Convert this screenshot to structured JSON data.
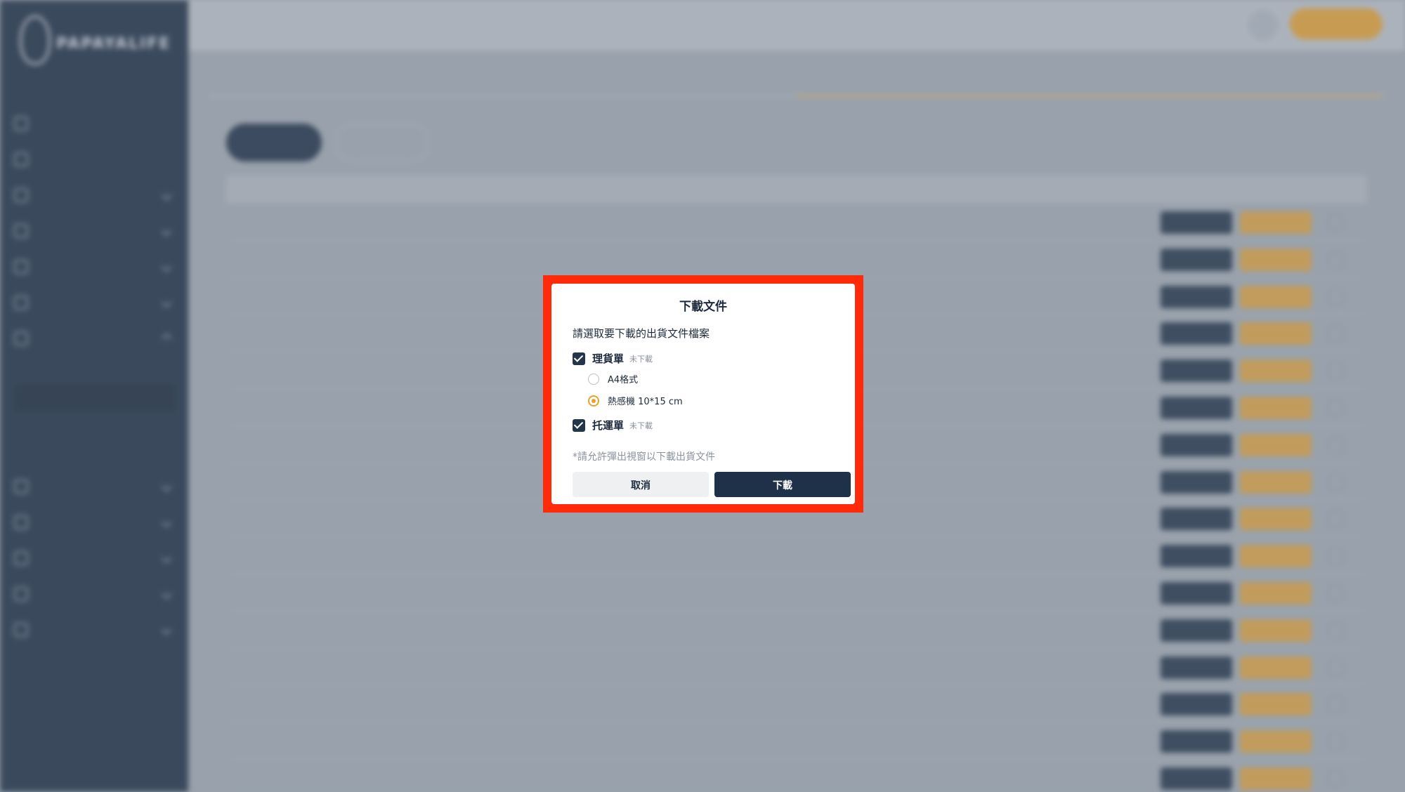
{
  "app": {
    "brand": "PAPAYALIFE",
    "brand_sub": "",
    "page_title": "",
    "breadcrumbs": [
      "",
      ""
    ],
    "user_label": ""
  },
  "sidebar": {
    "items": [
      {
        "label": "",
        "icon": "home-icon"
      },
      {
        "label": "",
        "icon": "chart-icon"
      },
      {
        "label": "",
        "icon": "store-icon"
      },
      {
        "label": "",
        "icon": "page-icon"
      },
      {
        "label": "",
        "icon": "list-icon"
      },
      {
        "label": "",
        "icon": "bag-icon"
      },
      {
        "label": "",
        "icon": "order-icon"
      },
      {
        "label": "",
        "icon": "users-icon"
      },
      {
        "label": "",
        "icon": "cart-icon"
      },
      {
        "label": "",
        "icon": "tag-icon"
      },
      {
        "label": "",
        "icon": "gear-icon"
      },
      {
        "label": "",
        "icon": "admin-icon"
      }
    ],
    "sub_items": [
      "",
      "",
      "",
      ""
    ],
    "footer": ""
  },
  "content": {
    "tabs": [
      "",
      ""
    ],
    "pills": [
      "",
      ""
    ],
    "export_label": "",
    "columns": [
      "",
      "",
      "",
      "",
      "",
      ""
    ],
    "row_count": 16
  },
  "modal": {
    "title": "下載文件",
    "prompt": "請選取要下載的出貨文件檔案",
    "option1": {
      "label": "理貨單",
      "status": "未下載",
      "checked": true
    },
    "format_a4": "A4格式",
    "format_thermal": "熱感機 10*15 cm",
    "selected_format": "熱感機 10*15 cm",
    "option2": {
      "label": "托運單",
      "status": "未下載",
      "checked": true
    },
    "hint": "*請允許彈出視窗以下載出貨文件",
    "cancel_label": "取消",
    "download_label": "下載"
  },
  "colors": {
    "sidebar_bg": "#1c2d43",
    "accent_gold": "#e8a22f",
    "primary_dark": "#1f3049",
    "highlight_frame": "#ff2a0a"
  }
}
